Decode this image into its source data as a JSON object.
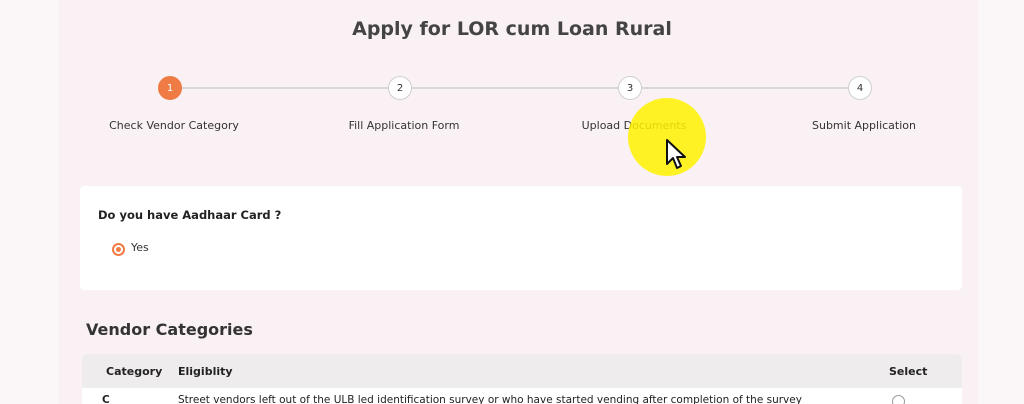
{
  "page": {
    "title": "Apply for LOR cum Loan Rural"
  },
  "stepper": {
    "steps": [
      {
        "number": "1",
        "label": "Check Vendor Category",
        "state": "active"
      },
      {
        "number": "2",
        "label": "Fill Application Form",
        "state": "pending"
      },
      {
        "number": "3",
        "label": "Upload Documents",
        "state": "pending"
      },
      {
        "number": "4",
        "label": "Submit Application",
        "state": "pending"
      }
    ]
  },
  "aadhaar": {
    "question": "Do you have Aadhaar Card ?",
    "option_label": "Yes",
    "selected": true
  },
  "vendor_categories": {
    "title": "Vendor Categories",
    "columns": [
      "Category",
      "Eligiblity",
      "Select"
    ],
    "rows": [
      {
        "category": "C",
        "eligibility": "Street vendors left out of the ULB led identification survey or who have started vending after completion of the survey"
      }
    ]
  },
  "colors": {
    "accent": "#ef7b45",
    "cursor_highlight": "#fff200"
  },
  "icons": {
    "cursor": "mouse-pointer-icon"
  }
}
